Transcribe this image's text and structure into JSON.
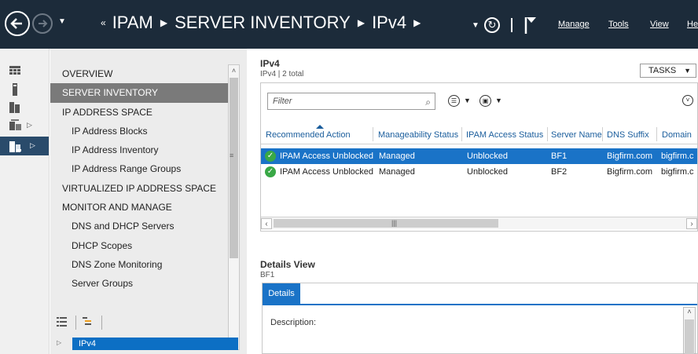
{
  "titlebar": {
    "breadcrumb_lead": "«",
    "breadcrumbs": [
      "IPAM",
      "SERVER INVENTORY",
      "IPv4"
    ],
    "menu": [
      "Manage",
      "Tools",
      "View",
      "He"
    ]
  },
  "nav": {
    "items": [
      {
        "label": "OVERVIEW",
        "sub": false,
        "selected": false
      },
      {
        "label": "SERVER INVENTORY",
        "sub": false,
        "selected": true
      },
      {
        "label": "IP ADDRESS SPACE",
        "sub": false,
        "selected": false
      },
      {
        "label": "IP Address Blocks",
        "sub": true,
        "selected": false
      },
      {
        "label": "IP Address Inventory",
        "sub": true,
        "selected": false
      },
      {
        "label": "IP Address Range Groups",
        "sub": true,
        "selected": false
      },
      {
        "label": "VIRTUALIZED IP ADDRESS SPACE",
        "sub": false,
        "selected": false
      },
      {
        "label": "MONITOR AND MANAGE",
        "sub": false,
        "selected": false
      },
      {
        "label": "DNS and DHCP Servers",
        "sub": true,
        "selected": false
      },
      {
        "label": "DHCP Scopes",
        "sub": true,
        "selected": false
      },
      {
        "label": "DNS Zone Monitoring",
        "sub": true,
        "selected": false
      },
      {
        "label": "Server Groups",
        "sub": true,
        "selected": false
      }
    ],
    "tree_selected": "IPv4"
  },
  "main": {
    "title": "IPv4",
    "subtitle": "IPv4 | 2 total",
    "tasks_label": "TASKS",
    "filter_placeholder": "Filter",
    "columns": [
      "Recommended Action",
      "Manageability Status",
      "IPAM Access Status",
      "Server Name",
      "DNS Suffix",
      "Domain"
    ],
    "rows": [
      {
        "action": "IPAM Access Unblocked",
        "manageability": "Managed",
        "access": "Unblocked",
        "server": "BF1",
        "suffix": "Bigfirm.com",
        "domain": "bigfirm.c",
        "selected": true
      },
      {
        "action": "IPAM Access Unblocked",
        "manageability": "Managed",
        "access": "Unblocked",
        "server": "BF2",
        "suffix": "Bigfirm.com",
        "domain": "bigfirm.c",
        "selected": false
      }
    ]
  },
  "details": {
    "title": "Details View",
    "subtitle": "BF1",
    "tab": "Details",
    "description_label": "Description:"
  },
  "colors": {
    "titlebar": "#1c2b3a",
    "selection": "#1a73c7",
    "nav_selected": "#7a7a7a",
    "status_ok": "#39a846"
  }
}
